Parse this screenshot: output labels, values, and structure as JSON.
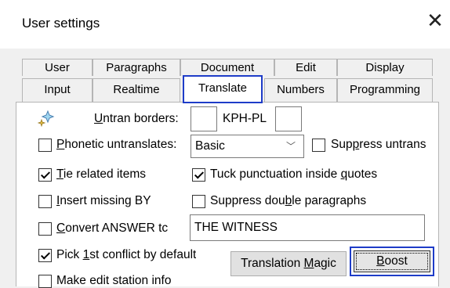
{
  "window": {
    "title": "User settings",
    "close_glyph": "✕"
  },
  "tabs_row1": [
    "User",
    "Paragraphs",
    "Document",
    "Edit",
    "Display"
  ],
  "tabs_row2": [
    "Input",
    "Realtime",
    "Translate",
    "Numbers",
    "Programming"
  ],
  "selected_tab": "Translate",
  "icon": "sparkle-icon",
  "untran_borders": {
    "label_pre": "",
    "label_u": "U",
    "label_post": "ntran borders:",
    "left_value": "",
    "middle_text": "KPH-PL",
    "right_value": ""
  },
  "phonetic": {
    "label_u": "P",
    "label_post": "honetic untranslates:",
    "checked": false,
    "select_value": "Basic"
  },
  "suppress_untrans": {
    "label_pre": "Sup",
    "label_u": "p",
    "label_post": "ress untrans",
    "checked": false
  },
  "tie_related": {
    "label_u": "T",
    "label_post": "ie related items",
    "checked": true
  },
  "tuck_punct": {
    "label_pre": "Tuck punctuation inside ",
    "label_u": "q",
    "label_post": "uotes",
    "checked": true
  },
  "insert_missing": {
    "label_u": "I",
    "label_post": "nsert missing BY",
    "checked": false
  },
  "suppress_double": {
    "label_pre": "Suppress dou",
    "label_u": "b",
    "label_post": "le paragraphs",
    "checked": false
  },
  "convert_answer": {
    "label_u": "C",
    "label_post": "onvert ANSWER tc",
    "checked": false,
    "value": "THE WITNESS"
  },
  "pick_first": {
    "label_pre": "Pick ",
    "label_u": "1",
    "label_post": "st conflict by default",
    "checked": true
  },
  "make_edit": {
    "label": "Make edit station info",
    "checked": false
  },
  "buttons": {
    "translation_magic_pre": "Translation ",
    "translation_magic_u": "M",
    "translation_magic_post": "agic",
    "boost_u": "B",
    "boost_post": "oost"
  },
  "colors": {
    "highlight": "#1e3cc8"
  }
}
